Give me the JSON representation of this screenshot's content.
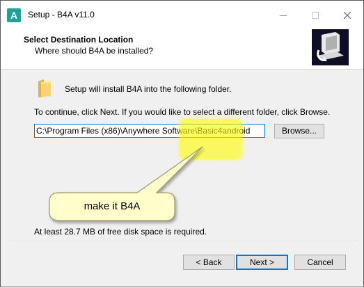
{
  "window": {
    "title": "Setup - B4A v11.0",
    "app_icon_letter": "A"
  },
  "header": {
    "title": "Select Destination Location",
    "subtitle": "Where should B4A be installed?"
  },
  "body": {
    "install_text": "Setup will install B4A into the following folder.",
    "continue_text": "To continue, click Next. If you would like to select a different folder, click Browse.",
    "path_value": "C:\\Program Files (x86)\\Anywhere Software\\Basic4android",
    "browse_label": "Browse...",
    "disk_space_text": "At least 28.7 MB of free disk space is required."
  },
  "annotation": {
    "callout_text": "make it B4A",
    "highlight_color": "#ffff00",
    "callout_color": "#ffffcc"
  },
  "footer": {
    "back_label": "< Back",
    "next_label": "Next >",
    "cancel_label": "Cancel"
  },
  "icons": [
    "setup-app-icon",
    "minimize-icon",
    "maximize-icon",
    "close-icon",
    "wizard-computer-icon",
    "folder-icon"
  ]
}
